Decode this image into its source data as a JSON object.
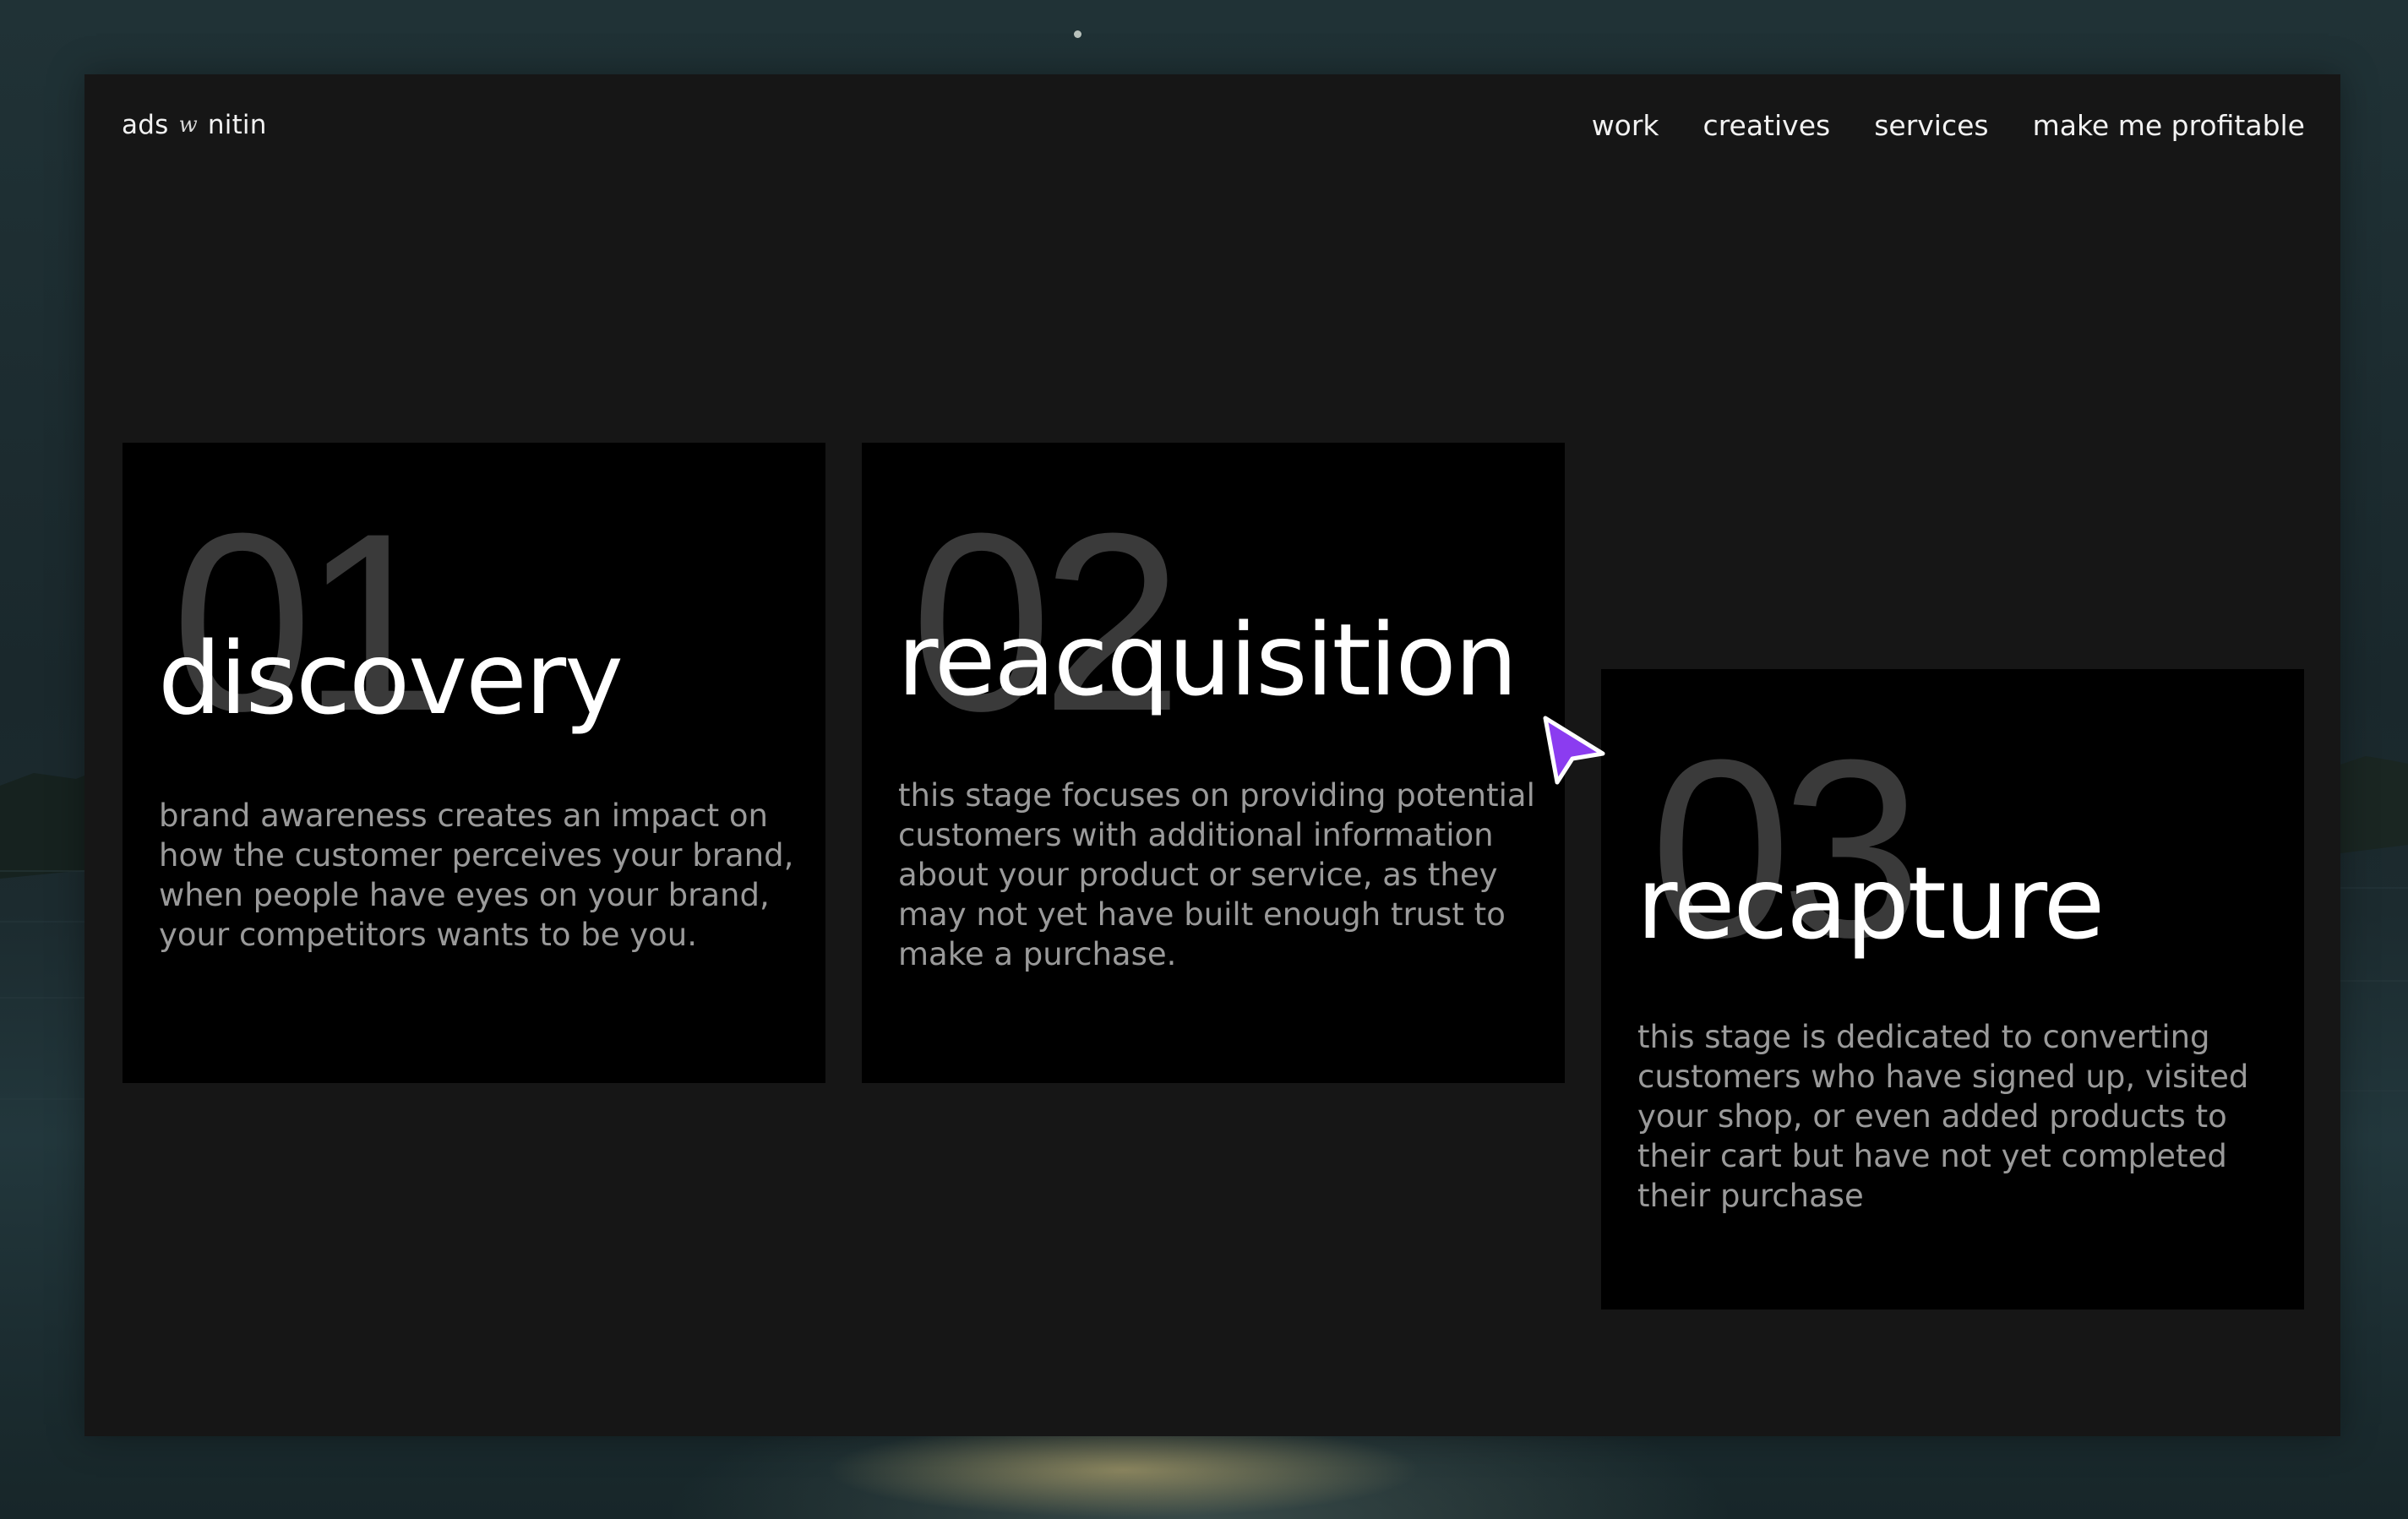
{
  "brand": {
    "left": "ads",
    "mid": "w",
    "right": "nitin"
  },
  "nav": {
    "items": [
      "work",
      "creatives",
      "services",
      "make me profitable"
    ]
  },
  "stages": [
    {
      "number": "01",
      "title": "discovery",
      "description": "brand awareness creates an impact on how the customer perceives your brand, when people have eyes on your brand, your competitors wants to be you."
    },
    {
      "number": "02",
      "title": "reacquisition",
      "description": "this stage focuses on providing potential customers with additional information about your product or service, as they may not yet have built enough trust to make a purchase."
    },
    {
      "number": "03",
      "title": "recapture",
      "description": "this stage is dedicated to converting customers who have signed up, visited your shop, or even added products to their cart but have not yet completed their purchase"
    }
  ],
  "colors": {
    "window_bg": "#161616",
    "card_bg": "#000000",
    "number_color": "#3a3a3a",
    "title_color": "#ffffff",
    "description_color": "#9a9a9a",
    "cursor_color": "#8b3cf0"
  },
  "icons": {
    "cursor": "pointer-arrow-icon"
  }
}
